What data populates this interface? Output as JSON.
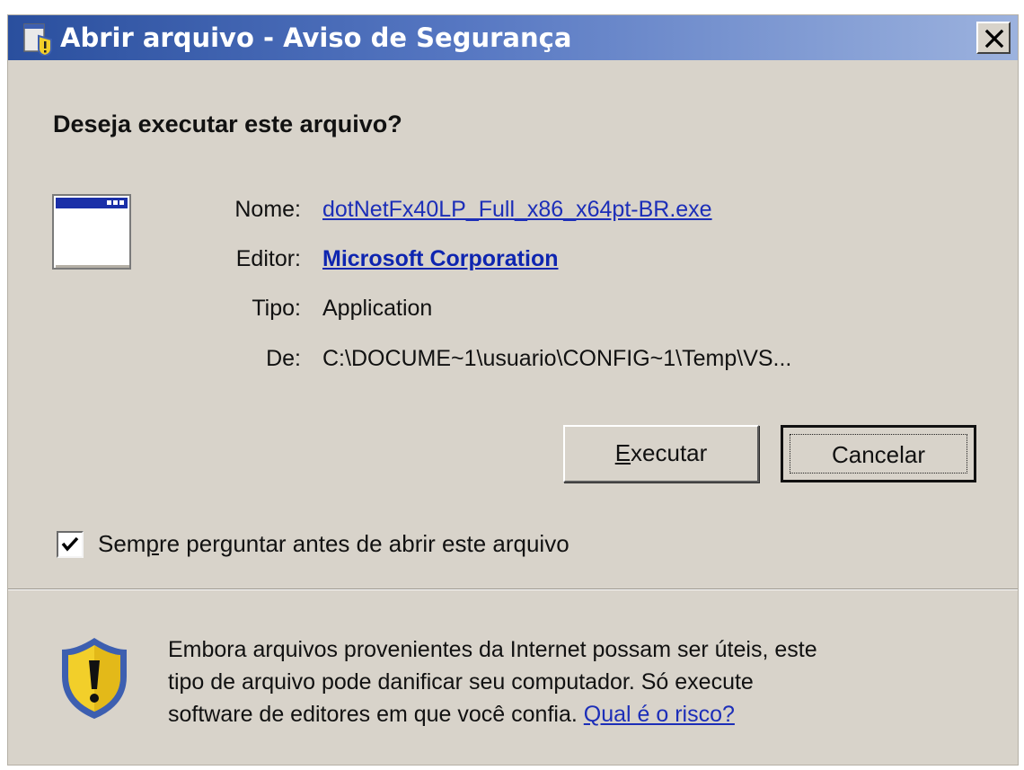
{
  "window": {
    "title": "Abrir arquivo - Aviso de Segurança",
    "close_label": "Fechar"
  },
  "prompt": {
    "question": "Deseja executar este arquivo?"
  },
  "details": {
    "name_label": "Nome:",
    "name_value": "dotNetFx40LP_Full_x86_x64pt-BR.exe",
    "publisher_label": "Editor:",
    "publisher_value": "Microsoft Corporation",
    "type_label": "Tipo:",
    "type_value": "Application",
    "from_label": "De:",
    "from_value": "C:\\DOCUME~1\\usuario\\CONFIG~1\\Temp\\VS..."
  },
  "buttons": {
    "run_accel": "E",
    "run_rest": "xecutar",
    "cancel_label": "Cancelar"
  },
  "checkbox": {
    "checked": true,
    "label_pre": "Sem",
    "label_accel": "p",
    "label_post": "re perguntar antes de abrir este arquivo"
  },
  "warning": {
    "line1": "Embora arquivos provenientes da Internet possam ser úteis, este",
    "line2": "tipo de arquivo pode danificar seu computador. Só execute",
    "line3_text": "software de editores em que você confia.",
    "link": "Qual é o risco?"
  },
  "icons": {
    "title": "security-warning-icon",
    "app": "application-window-icon",
    "shield": "warning-shield-icon",
    "close": "close-x-icon"
  },
  "colors": {
    "title_start": "#2a4f9e",
    "title_end": "#9cb2de",
    "dialog_bg": "#d8d3ca",
    "link": "#1c2eb8",
    "shield_yellow": "#f2cf2a",
    "shield_blue": "#3d5fb0"
  }
}
